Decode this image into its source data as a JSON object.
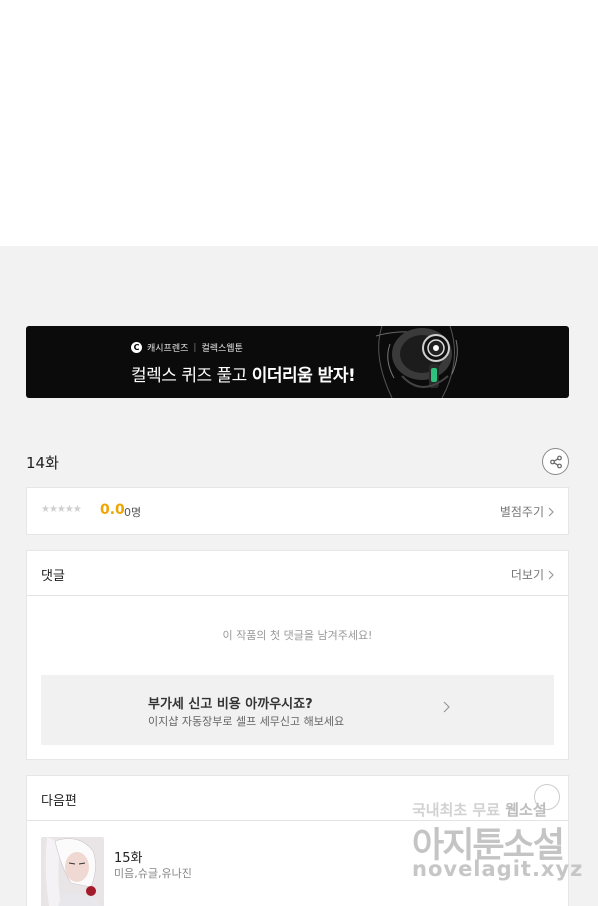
{
  "banner": {
    "brand_icon": "C",
    "brand": "캐시프렌즈",
    "brand_separator": "|",
    "partner": "컬렉스웹툰",
    "headline_part1": "컬렉스 퀴즈 풀고 ",
    "headline_part2": "이더리움 받자!",
    "colors": {
      "background": "#0b0b0b",
      "accent": "#2ec27e"
    }
  },
  "episode": {
    "title": "14화",
    "share_icon": "share-icon"
  },
  "rating": {
    "stars": "★★★★★",
    "score": "0.0",
    "count": "0명",
    "rate_label": "별점주기",
    "score_color": "#f0a400"
  },
  "comments": {
    "title": "댓글",
    "more_label": "더보기",
    "empty_message": "이 작품의 첫 댓글을 남겨주세요!",
    "ad": {
      "title": "부가세 신고 비용 아까우시죠?",
      "subtitle": "이지샵 자동장부로 셀프 세무신고 해보세요"
    }
  },
  "next_episode": {
    "title": "다음편",
    "episode_title": "15화",
    "authors": "미음,슈글,유나진"
  },
  "watermark": {
    "line1_part1": "국내최초 무료 ",
    "line1_part2": "웹소설",
    "line2": "아지툰소설",
    "line3": "novelagit.xyz"
  }
}
